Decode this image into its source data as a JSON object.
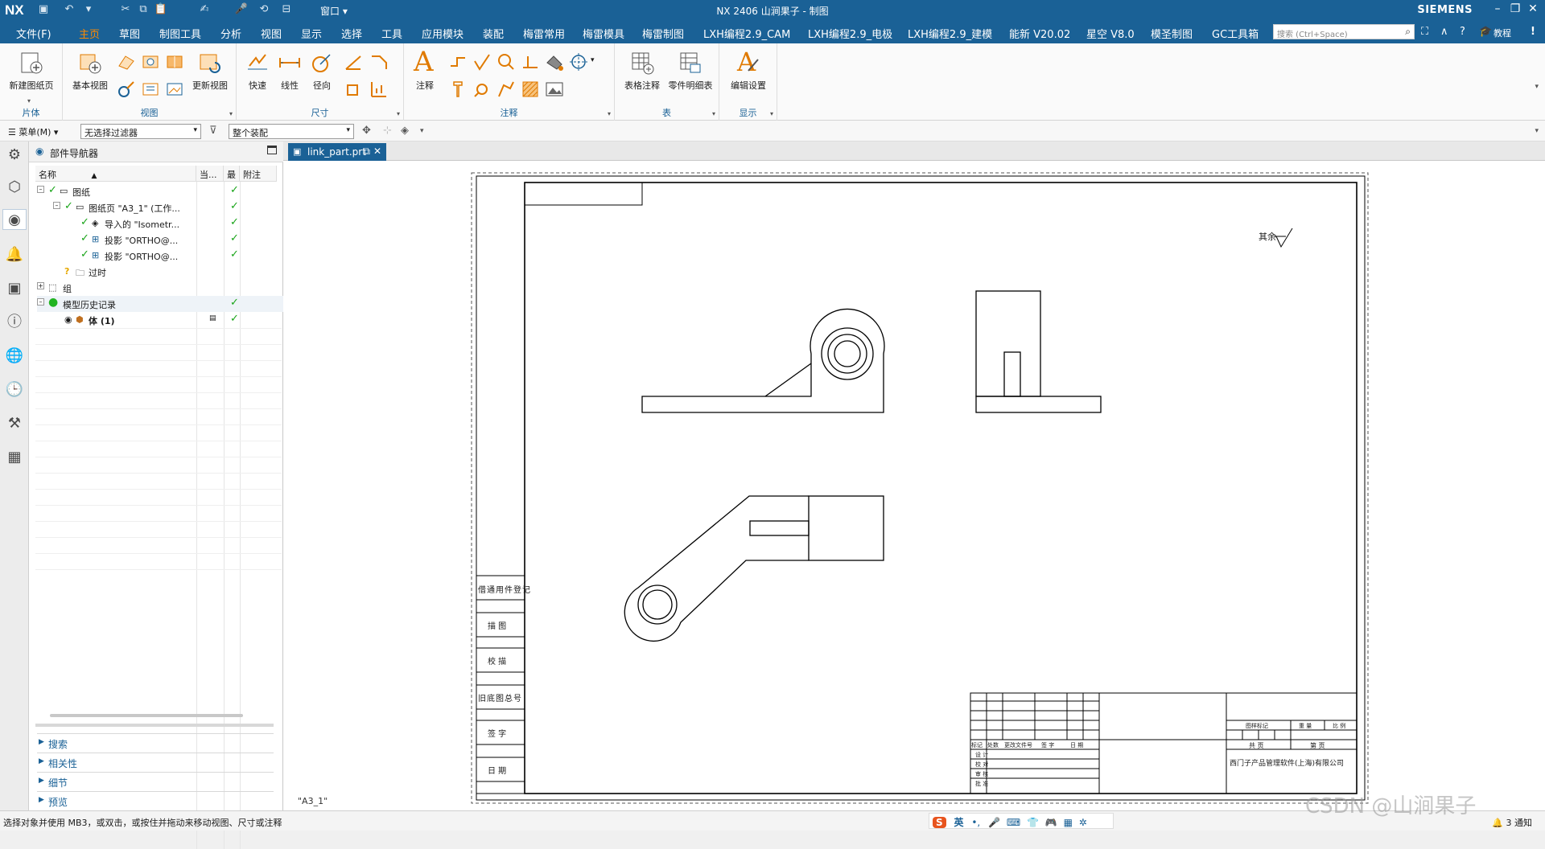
{
  "titlebar": {
    "logo": "NX",
    "window_menu": "窗口 ▾",
    "title": "NX 2406 山涧果子 - 制图",
    "brand": "SIEMENS"
  },
  "menubar": {
    "file": "文件(F)",
    "tabs": [
      "主页",
      "草图",
      "制图工具",
      "分析",
      "视图",
      "显示",
      "选择",
      "工具",
      "应用模块",
      "装配",
      "梅雷常用",
      "梅雷模具",
      "梅雷制图",
      "LXH编程2.9_CAM",
      "LXH编程2.9_电极",
      "LXH编程2.9_建模",
      "能新 V20.02",
      "星空 V8.0",
      "模圣制图",
      "GC工具箱"
    ],
    "active_tab": "主页",
    "search_placeholder": "搜索 (Ctrl+Space)",
    "help_label": "教程"
  },
  "ribbon": {
    "groups": [
      {
        "label": "片体",
        "buttons": [
          "新建图纸页"
        ]
      },
      {
        "label": "视图",
        "buttons": [
          "基本视图",
          "更新视图"
        ]
      },
      {
        "label": "尺寸",
        "buttons": [
          "快速",
          "线性",
          "径向"
        ]
      },
      {
        "label": "注释",
        "buttons": [
          "注释"
        ]
      },
      {
        "label": "表",
        "buttons": [
          "表格注释",
          "零件明细表"
        ]
      },
      {
        "label": "显示",
        "buttons": [
          "编辑设置"
        ]
      }
    ]
  },
  "selbar": {
    "menu": "菜单(M) ▾",
    "filter": "无选择过滤器",
    "scope": "整个装配"
  },
  "navigator": {
    "title": "部件导航器",
    "columns": [
      "名称",
      "当...",
      "最",
      "附注"
    ],
    "rows": [
      {
        "label": "图纸",
        "level": 0,
        "status": true
      },
      {
        "label": "图纸页 \"A3_1\" (工作...",
        "level": 1,
        "status": true
      },
      {
        "label": "导入的 \"Isometr...",
        "level": 2,
        "status": true
      },
      {
        "label": "投影 \"ORTHO@...",
        "level": 2,
        "status": true
      },
      {
        "label": "投影 \"ORTHO@...",
        "level": 2,
        "status": true
      },
      {
        "label": "过时",
        "level": 1,
        "status": false
      },
      {
        "label": "组",
        "level": 0,
        "status": false
      },
      {
        "label": "模型历史记录",
        "level": 0,
        "status": true
      },
      {
        "label": "体 (1)",
        "level": 1,
        "status": true
      }
    ],
    "sections": [
      "搜索",
      "相关性",
      "细节",
      "预览"
    ]
  },
  "document": {
    "tab": "link_part.prt",
    "sheet_name": "\"A3_1\""
  },
  "drawing": {
    "surface_note": "其余",
    "left_table": [
      "借通用件登记",
      "描 图",
      "校 描",
      "旧底图总号",
      "签 字",
      "日 期"
    ],
    "title_block": {
      "headers": [
        "标记",
        "处数",
        "更改文件号",
        "签 字",
        "日 期"
      ],
      "roles": [
        "设 计",
        "校 对",
        "审 核",
        "批 准"
      ],
      "right_top": [
        "图样标记",
        "重 量",
        "比 例"
      ],
      "pages": [
        "共 页",
        "第 页"
      ],
      "company": "西门子产品管理软件(上海)有限公司"
    }
  },
  "status": {
    "message": "选择对象并使用 MB3，或双击，或按住并拖动来移动视图、尺寸或注释",
    "ime_lang": "英",
    "notifications": "3 通知",
    "watermark": "CSDN @山涧果子"
  },
  "colors": {
    "titlebar": "#1a6196",
    "active_tab": "#ff8a00",
    "check": "#18a418"
  }
}
